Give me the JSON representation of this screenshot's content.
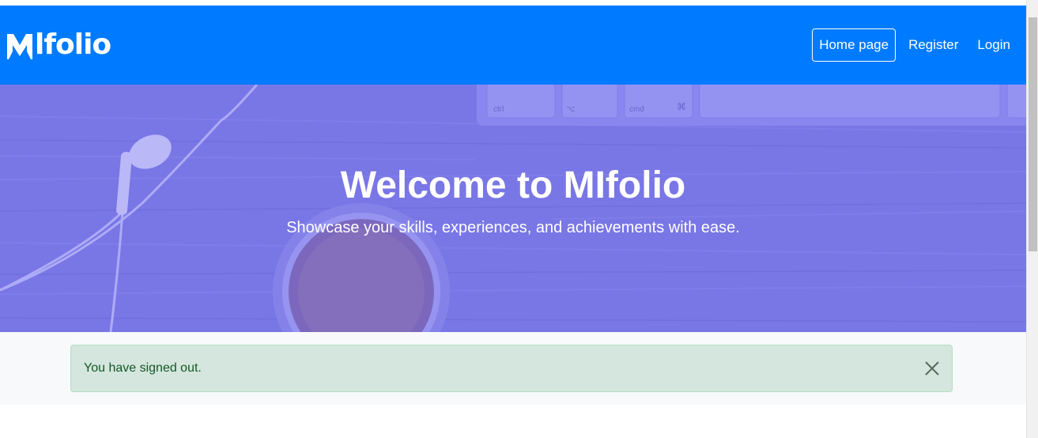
{
  "brand": {
    "name": "Mlfolio"
  },
  "nav": {
    "items": [
      {
        "label": "Home page",
        "active": true
      },
      {
        "label": "Register",
        "active": false
      },
      {
        "label": "Login",
        "active": false
      }
    ]
  },
  "hero": {
    "title": "Welcome to MIfolio",
    "subtitle": "Showcase your skills, experiences, and achievements with ease."
  },
  "alert": {
    "message": "You have signed out.",
    "close_icon": "close-icon"
  },
  "colors": {
    "primary": "#007bff",
    "hero_overlay": "#7b78e8",
    "alert_bg": "#d4e6dd",
    "alert_text": "#155724"
  }
}
